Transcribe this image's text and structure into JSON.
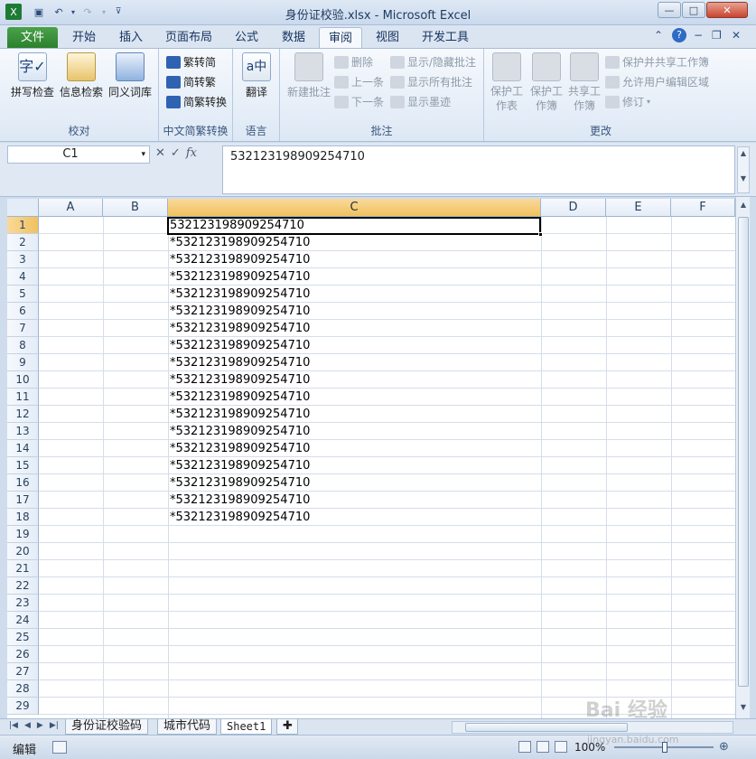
{
  "window": {
    "title": "身份证校验.xlsx - Microsoft Excel",
    "minimize": "—",
    "maximize": "□",
    "close": "✕"
  },
  "quick_access": [
    "save-icon",
    "undo-icon",
    "redo-icon",
    "customize-icon"
  ],
  "tabs": [
    {
      "label": "文件"
    },
    {
      "label": "开始"
    },
    {
      "label": "插入"
    },
    {
      "label": "页面布局"
    },
    {
      "label": "公式"
    },
    {
      "label": "数据"
    },
    {
      "label": "审阅"
    },
    {
      "label": "视图"
    },
    {
      "label": "开发工具"
    }
  ],
  "ribbon": {
    "groups": {
      "proofing": {
        "label": "校对",
        "spellcheck": "拼写检查",
        "research": "信息检索",
        "thesaurus": "同义词库"
      },
      "chinese": {
        "label": "中文简繁转换",
        "to_simplified": "繁转简",
        "to_traditional": "简转繁",
        "convert": "简繁转换"
      },
      "language": {
        "label": "语言",
        "translate": "翻译"
      },
      "comments": {
        "label": "批注",
        "new_comment": "新建批注",
        "delete": "删除",
        "previous": "上一条",
        "next": "下一条",
        "show_hide": "显示/隐藏批注",
        "show_all": "显示所有批注",
        "show_ink": "显示墨迹"
      },
      "changes": {
        "label": "更改",
        "protect_sheet": "保护工作表",
        "protect_workbook": "保护工作簿",
        "share_workbook": "共享工作簿",
        "protect_share": "保护并共享工作簿",
        "allow_edit": "允许用户编辑区域",
        "track_changes": "修订"
      }
    }
  },
  "formula_bar": {
    "name_box": "C1",
    "fx": "fx",
    "formula": "532123198909254710"
  },
  "sheet": {
    "columns": [
      "A",
      "B",
      "C",
      "D",
      "E",
      "F"
    ],
    "rows": [
      "1",
      "2",
      "3",
      "4",
      "5",
      "6",
      "7",
      "8",
      "9",
      "10",
      "11",
      "12",
      "13",
      "14",
      "15",
      "16",
      "17",
      "18",
      "19",
      "20",
      "21",
      "22",
      "23",
      "24",
      "25",
      "26",
      "27",
      "28",
      "29"
    ],
    "c_values": [
      "532123198909254710",
      "*532123198909254710",
      "*532123198909254710",
      "*532123198909254710",
      "*532123198909254710",
      "*532123198909254710",
      "*532123198909254710",
      "*532123198909254710",
      "*532123198909254710",
      "*532123198909254710",
      "*532123198909254710",
      "*532123198909254710",
      "*532123198909254710",
      "*532123198909254710",
      "*532123198909254710",
      "*532123198909254710",
      "*532123198909254710",
      "*532123198909254710"
    ]
  },
  "sheet_tabs": [
    "身份证校验码",
    "城市代码",
    "Sheet1"
  ],
  "status": {
    "mode": "编辑",
    "zoom": "100%"
  },
  "watermark": {
    "main": "Bai 经验",
    "sub": "jingyan.baidu.com"
  }
}
